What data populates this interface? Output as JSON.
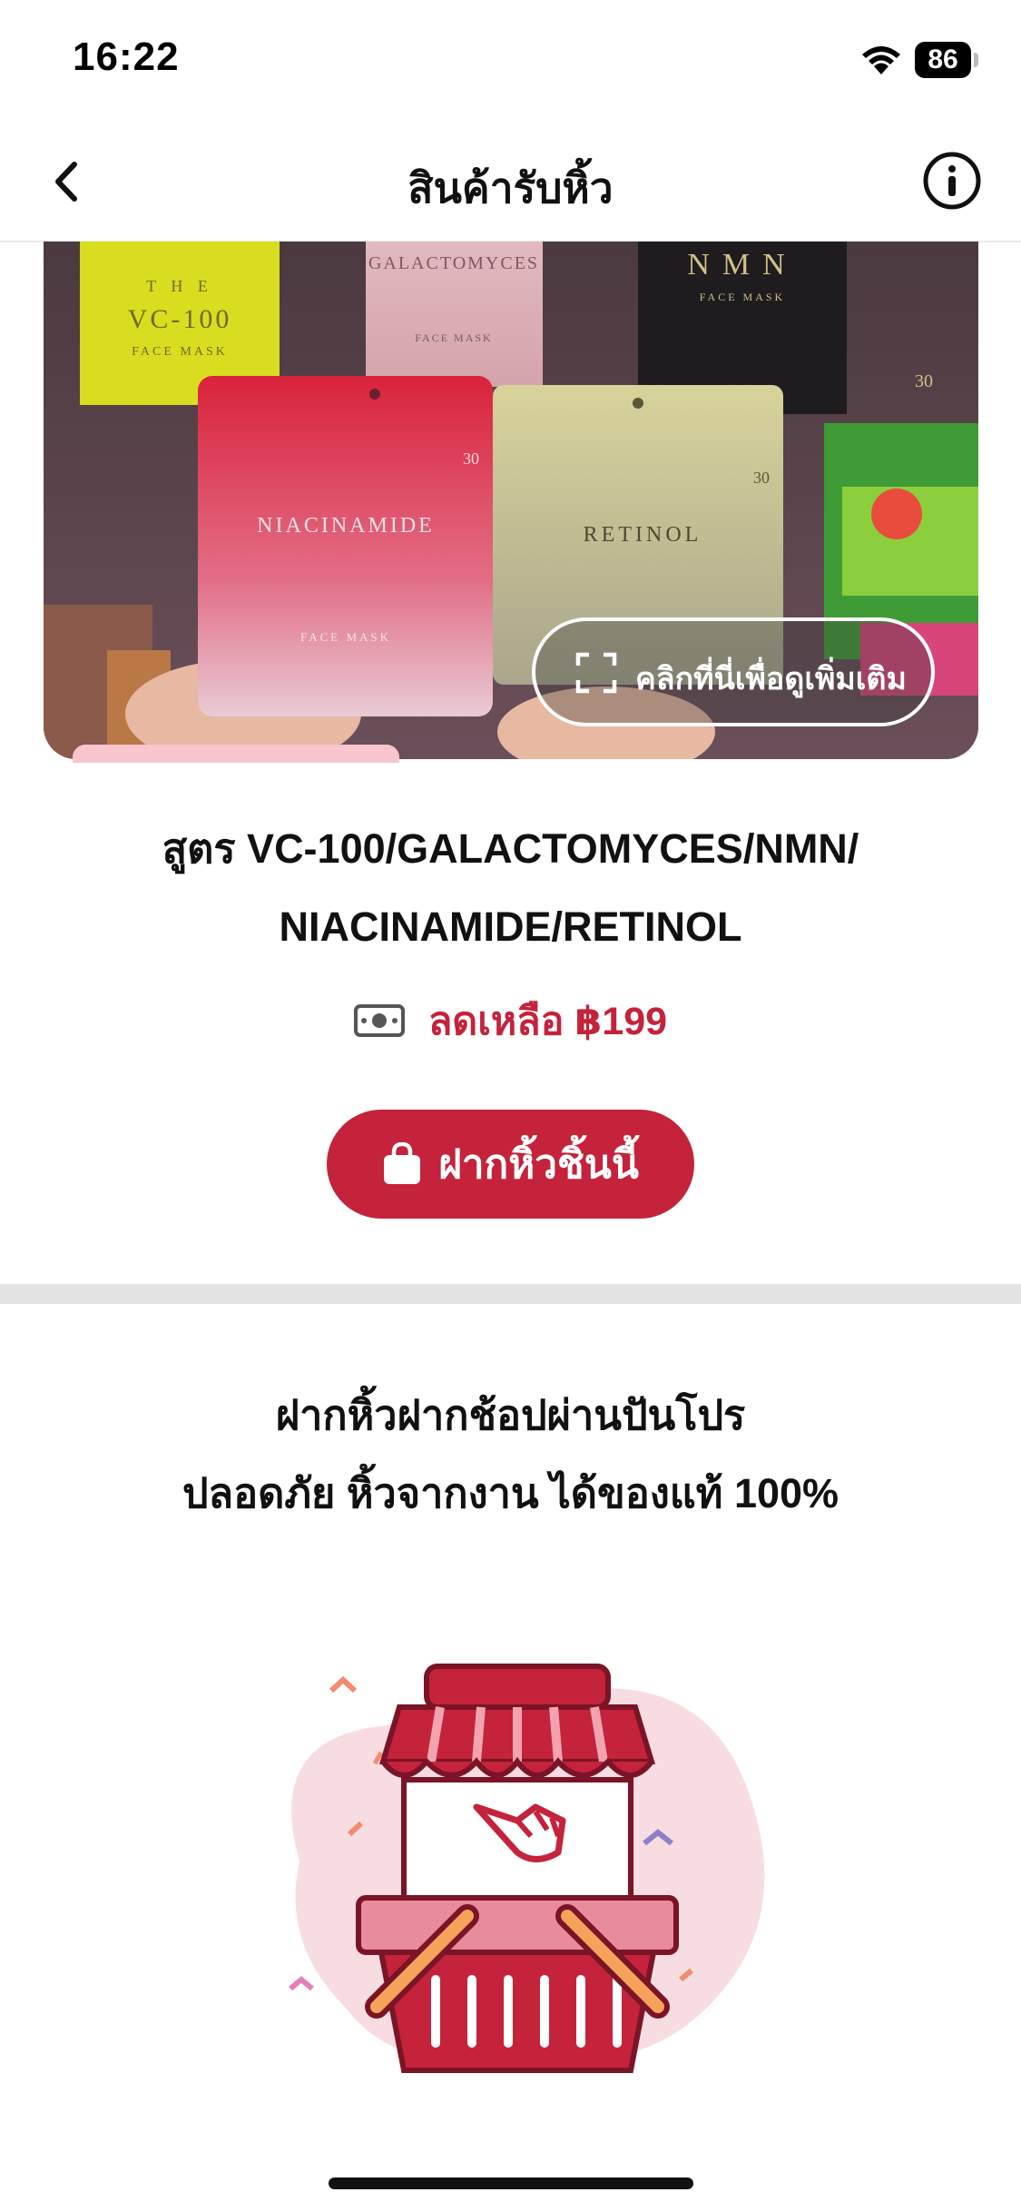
{
  "status_bar": {
    "time": "16:22",
    "battery": "86"
  },
  "nav": {
    "title": "สินค้ารับหิ้ว",
    "back_icon": "chevron-left-icon",
    "info_icon": "info-circle-icon"
  },
  "hero": {
    "view_more_label": "คลิกที่นี่เพื่อดูเพิ่มเติม",
    "product_labels": [
      "VC-100",
      "GALACTOMYCES",
      "NMN",
      "NIACINAMIDE",
      "RETINOL"
    ]
  },
  "product": {
    "title_line1": "สูตร VC-100/GALACTOMYCES/NMN/",
    "title_line2": "NIACINAMIDE/RETINOL",
    "price": "ลดเหลือ ฿199",
    "deposit_button": "ฝากหิ้วชิ้นนี้"
  },
  "promo": {
    "line1": "ฝากหิ้วฝากช้อปผ่านปันโปร",
    "line2": "ปลอดภัย หิ้วจากงาน ได้ของแท้ 100%"
  },
  "colors": {
    "accent": "#c4233b",
    "divider": "#e3e3e3"
  }
}
